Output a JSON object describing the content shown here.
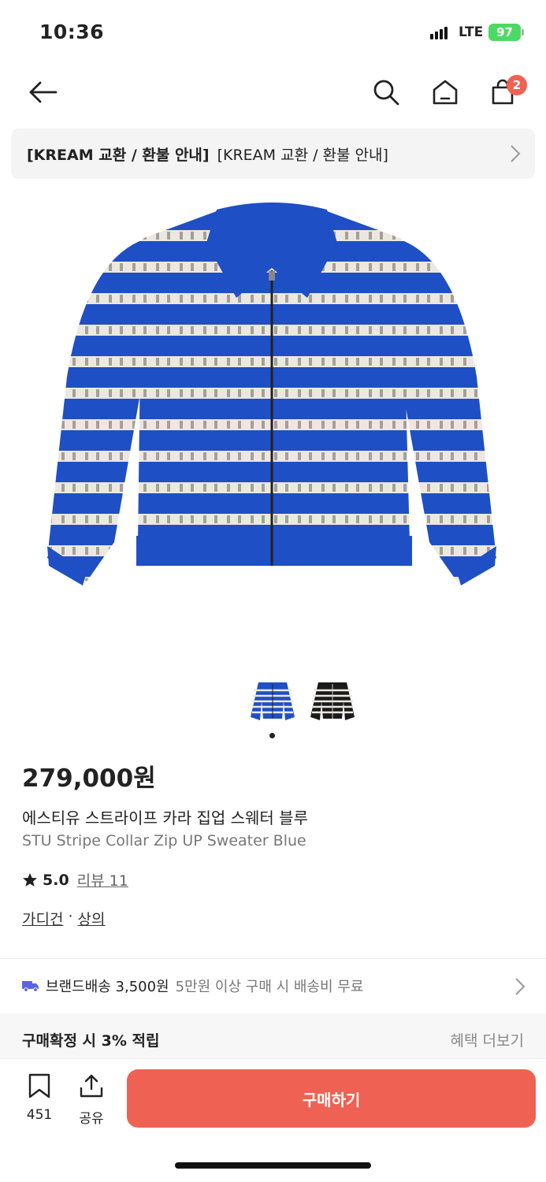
{
  "status": {
    "time": "10:36",
    "network": "LTE",
    "battery": "97"
  },
  "header": {
    "icons": [
      "back-arrow-icon",
      "search-icon",
      "home-icon",
      "shopping-bag-icon"
    ],
    "cart_count": "2"
  },
  "notice": {
    "bold_text": "[KREAM 교환 / 환불 안내]",
    "text": "[KREAM 교환 / 환불 안내]"
  },
  "product": {
    "price": "279,000원",
    "name_ko": "에스티유 스트라이프 카라 집업 스웨터 블루",
    "name_en": "STU Stripe Collar Zip UP Sweater Blue",
    "rating": "5.0",
    "review_label": "리뷰 11",
    "category_1": "가디건",
    "separator": "·",
    "category_2": "상의",
    "colors": {
      "primary": "#1f4fc4",
      "stripe": "#ece8e0",
      "dark": "#1a1a1a"
    }
  },
  "thumbnails": [
    "blue",
    "black"
  ],
  "shipping": {
    "main": "브랜드배송 3,500원",
    "sub": "5만원 이상 구매 시 배송비 무료"
  },
  "benefit": {
    "title": "구매확정 시 3% 적립",
    "more": "혜택 더보기"
  },
  "bottom": {
    "save_count": "451",
    "share_label": "공유",
    "buy_label": "구매하기"
  },
  "accent_color": "#ef6253"
}
